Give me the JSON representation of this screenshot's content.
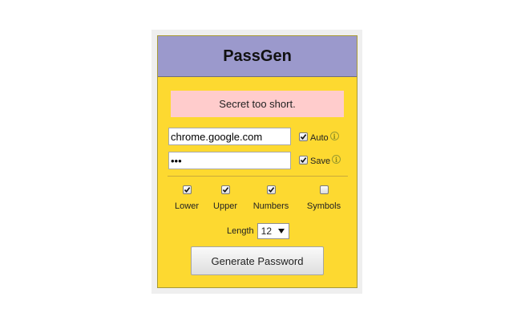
{
  "app": {
    "title": "PassGen"
  },
  "message": {
    "text": "Secret too short.",
    "background": "#ffcccc"
  },
  "site_field": {
    "value": "chrome.google.com"
  },
  "secret_field": {
    "value": "•••"
  },
  "options": {
    "auto": {
      "label": "Auto",
      "checked": true,
      "icon": "info-icon"
    },
    "save": {
      "label": "Save",
      "checked": true,
      "icon": "info-icon"
    }
  },
  "charsets": [
    {
      "label": "Lower",
      "checked": true
    },
    {
      "label": "Upper",
      "checked": true
    },
    {
      "label": "Numbers",
      "checked": true
    },
    {
      "label": "Symbols",
      "checked": false
    }
  ],
  "length": {
    "label": "Length",
    "value": "12"
  },
  "generate_button": {
    "label": "Generate Password"
  },
  "colors": {
    "panel": "#fdd930",
    "header": "#9b99cc"
  }
}
